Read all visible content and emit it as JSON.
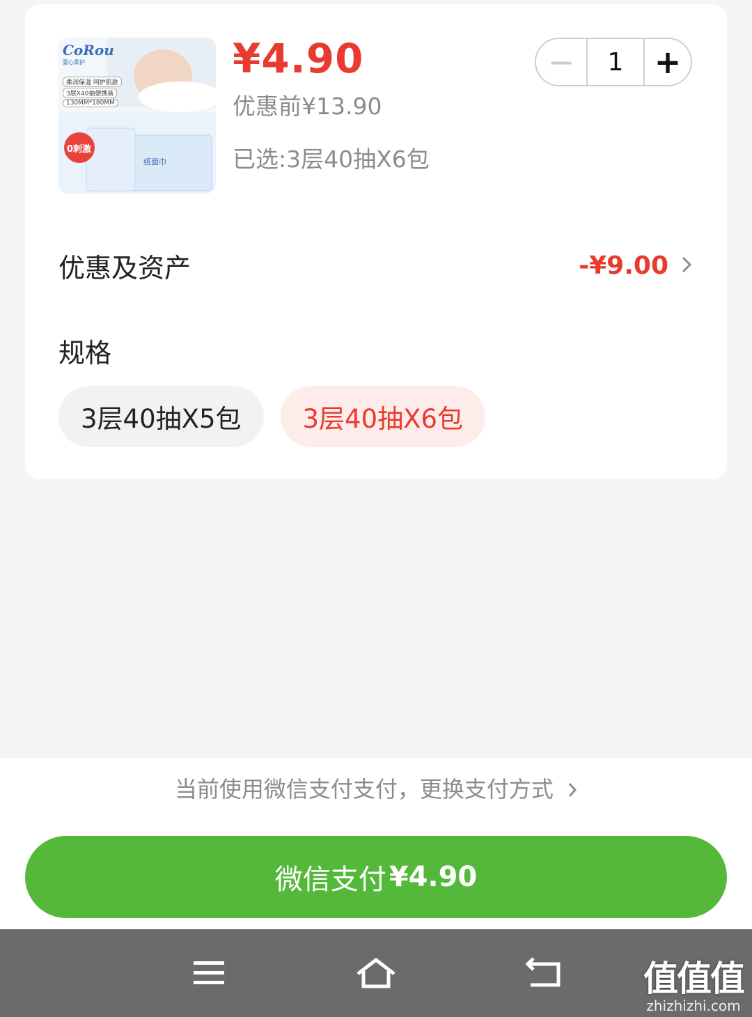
{
  "product": {
    "price": "¥4.90",
    "original_price": "优惠前¥13.90",
    "selected_spec": "已选:3层40抽X6包",
    "image": {
      "brand": "CoRou",
      "brand_cn": "婴心柔护",
      "tags": [
        "柔润保湿 呵护肌肤",
        "3层X40抽便携装",
        "130MM*180MM"
      ],
      "badge": "0刺激",
      "package_label": "纸面巾"
    }
  },
  "quantity": {
    "value": "1",
    "minus_label": "−",
    "plus_label": "+"
  },
  "discount": {
    "label": "优惠及资产",
    "amount": "-¥9.00"
  },
  "spec": {
    "title": "规格",
    "options": [
      {
        "label": "3层40抽X5包",
        "selected": false
      },
      {
        "label": "3层40抽X6包",
        "selected": true
      }
    ]
  },
  "payment": {
    "hint": "当前使用微信支付支付，更换支付方式",
    "button_label": "微信支付",
    "button_amount": "¥4.90"
  },
  "navbar": {
    "icons": [
      "menu-icon",
      "home-icon",
      "back-icon"
    ]
  },
  "watermark": {
    "main": "值值值",
    "sub": "zhizhizhi.com"
  },
  "colors": {
    "accent": "#e83a2f",
    "pay_green": "#54b93a",
    "navbar": "#6b6b6b"
  }
}
